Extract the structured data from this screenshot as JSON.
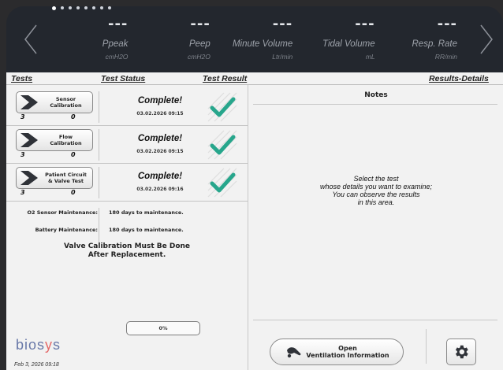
{
  "header": {
    "page_dots": 8,
    "params": [
      {
        "value": "---",
        "name": "Ppeak",
        "unit": "cmH2O"
      },
      {
        "value": "---",
        "name": "Peep",
        "unit": "cmH2O"
      },
      {
        "value": "---",
        "name": "Minute Volume",
        "unit": "Ltr/min"
      },
      {
        "value": "---",
        "name": "Tidal Volume",
        "unit": "mL"
      },
      {
        "value": "---",
        "name": "Resp. Rate",
        "unit": "RR/min"
      }
    ]
  },
  "columns": {
    "tests": "Tests",
    "status": "Test Status",
    "result": "Test Result",
    "details": "Results-Details"
  },
  "tests": [
    {
      "label_line1": "Sensor",
      "label_line2": "Calibration",
      "count_a": "3",
      "count_b": "0",
      "status": "Complete!",
      "timestamp": "03.02.2026 09:15",
      "result": "pass"
    },
    {
      "label_line1": "Flow",
      "label_line2": "Calibration",
      "count_a": "3",
      "count_b": "0",
      "status": "Complete!",
      "timestamp": "03.02.2026 09:15",
      "result": "pass"
    },
    {
      "label_line1": "Patient Circuit",
      "label_line2": "& Valve Test",
      "count_a": "3",
      "count_b": "0",
      "status": "Complete!",
      "timestamp": "03.02.2026 09:16",
      "result": "pass"
    }
  ],
  "maintenance": [
    {
      "label": "O2 Sensor Maintenance:",
      "value": "180 days to maintenance."
    },
    {
      "label": "Battery Maintenance:",
      "value": "180 days to maintenance."
    }
  ],
  "valve_message": {
    "line1": "Valve Calibration Must Be Done",
    "line2": "After Replacement."
  },
  "progress": {
    "label": "0%",
    "value": 0
  },
  "notes": {
    "title": "Notes",
    "msg_line1": "Select the test",
    "msg_line2": "whose details you want to examine;",
    "msg_line3": "You can observe the results",
    "msg_line4": "in this area."
  },
  "footer": {
    "logo_part1": "bios",
    "logo_part2": "y",
    "logo_part3": "s",
    "date": "Feb 3, 2026  09:18",
    "open_vent_line1": "Open",
    "open_vent_line2": "Ventilation Information"
  },
  "colors": {
    "check": "#27a68c",
    "header_bg": "#23272e",
    "panel_bg": "#f2f2f2",
    "logo": "#6878a8",
    "logo_accent": "#e46a6a"
  }
}
